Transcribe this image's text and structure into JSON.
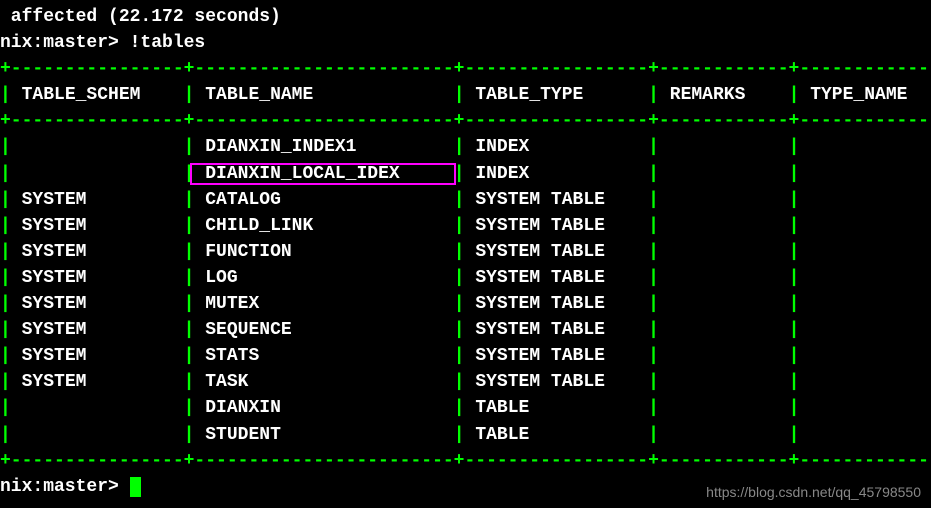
{
  "status_line": " affected (22.172 seconds)",
  "prompt_prefix": "nix:master>",
  "command": " !tables",
  "columns": {
    "col1": "TABLE_SCHEM",
    "col2": "TABLE_NAME",
    "col3": "TABLE_TYPE",
    "col4": "REMARKS",
    "col5": "TYPE_NAME"
  },
  "rows": [
    {
      "schem": "",
      "name": "DIANXIN_INDEX1",
      "type": "INDEX"
    },
    {
      "schem": "",
      "name": "DIANXIN_LOCAL_IDEX",
      "type": "INDEX"
    },
    {
      "schem": "SYSTEM",
      "name": "CATALOG",
      "type": "SYSTEM TABLE"
    },
    {
      "schem": "SYSTEM",
      "name": "CHILD_LINK",
      "type": "SYSTEM TABLE"
    },
    {
      "schem": "SYSTEM",
      "name": "FUNCTION",
      "type": "SYSTEM TABLE"
    },
    {
      "schem": "SYSTEM",
      "name": "LOG",
      "type": "SYSTEM TABLE"
    },
    {
      "schem": "SYSTEM",
      "name": "MUTEX",
      "type": "SYSTEM TABLE"
    },
    {
      "schem": "SYSTEM",
      "name": "SEQUENCE",
      "type": "SYSTEM TABLE"
    },
    {
      "schem": "SYSTEM",
      "name": "STATS",
      "type": "SYSTEM TABLE"
    },
    {
      "schem": "SYSTEM",
      "name": "TASK",
      "type": "SYSTEM TABLE"
    },
    {
      "schem": "",
      "name": "DIANXIN",
      "type": "TABLE"
    },
    {
      "schem": "",
      "name": "STUDENT",
      "type": "TABLE"
    }
  ],
  "highlight_row_index": 1,
  "watermark": "https://blog.csdn.net/qq_45798550"
}
